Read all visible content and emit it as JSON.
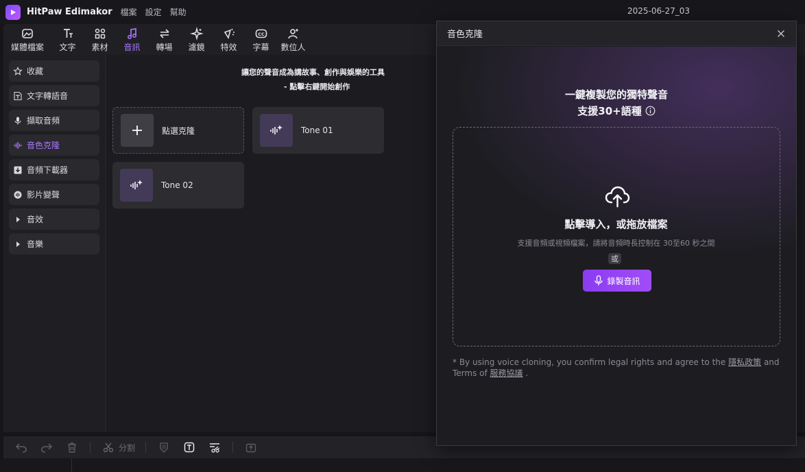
{
  "titlebar": {
    "app_name": "HitPaw Edimakor",
    "menus": [
      "檔案",
      "設定",
      "幫助"
    ],
    "project_name": "2025-06-27_03"
  },
  "toolbar": {
    "tools": [
      {
        "label": "媒體檔案",
        "icon": "media-icon"
      },
      {
        "label": "文字",
        "icon": "text-icon"
      },
      {
        "label": "素材",
        "icon": "elements-icon"
      },
      {
        "label": "音訊",
        "icon": "audio-icon",
        "active": true
      },
      {
        "label": "轉場",
        "icon": "transition-icon"
      },
      {
        "label": "濾鏡",
        "icon": "filter-icon"
      },
      {
        "label": "特效",
        "icon": "effects-icon"
      },
      {
        "label": "字幕",
        "icon": "subtitle-icon"
      },
      {
        "label": "數位人",
        "icon": "avatar-icon"
      }
    ]
  },
  "sidebar": {
    "items": [
      {
        "label": "收藏",
        "icon": "star-icon"
      },
      {
        "label": "文字轉語音",
        "icon": "text-to-speech-icon"
      },
      {
        "label": "擷取音頻",
        "icon": "microphone-icon"
      },
      {
        "label": "音色克隆",
        "icon": "voice-wave-icon",
        "active": true
      },
      {
        "label": "音頻下載器",
        "icon": "download-icon"
      },
      {
        "label": "影片變聲",
        "icon": "voice-changer-icon"
      },
      {
        "label": "音效",
        "icon": "caret-right-icon"
      },
      {
        "label": "音樂",
        "icon": "caret-right-icon"
      }
    ]
  },
  "main": {
    "intro_line1": "讓您的聲音成為講故事、創作與娛樂的工具",
    "intro_line2": "- 點擊右鍵開始創作",
    "add_card_label": "點選克隆",
    "tones": [
      "Tone 01",
      "Tone 02"
    ]
  },
  "bottombar": {
    "split_label": "分割"
  },
  "dialog": {
    "title": "音色克隆",
    "headline1": "一鍵複製您的獨特聲音",
    "headline2": "支援30+語種",
    "drop_title": "點擊導入，或拖放檔案",
    "drop_sub": "支援音頻或視頻檔案，請將音頻時長控制在 30至60 秒之間",
    "or_text": "或",
    "record_label": "錄製音訊",
    "disclaimer_part1": "* By using voice cloning, you confirm legal rights and agree to the ",
    "privacy_link": "隱私政策",
    "disclaimer_part2": " and Terms of ",
    "terms_link": "服務協議",
    "disclaimer_part3": " ."
  },
  "colors": {
    "accent": "#a975ff",
    "record_button": "#9642f5",
    "background": "#1c1c20"
  }
}
